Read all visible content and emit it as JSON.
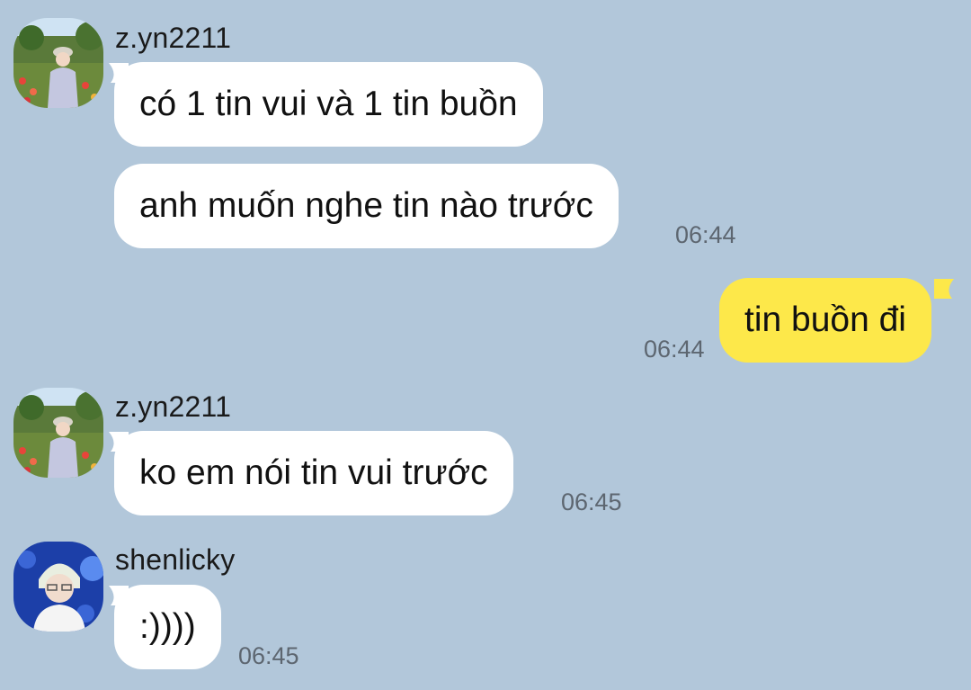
{
  "chat": {
    "messages": [
      {
        "sender": "z.yn2211",
        "avatar": "avatar-zyn2211",
        "text": "có 1 tin vui và 1 tin buồn"
      },
      {
        "sender": "z.yn2211",
        "text": "anh muốn nghe tin nào trước",
        "time": "06:44"
      },
      {
        "sender": "me",
        "text": "tin buồn đi",
        "time": "06:44"
      },
      {
        "sender": "z.yn2211",
        "avatar": "avatar-zyn2211",
        "text": "ko em nói tin vui trước",
        "time": "06:45"
      },
      {
        "sender": "shenlicky",
        "avatar": "avatar-shenlicky",
        "text": ":))))",
        "time": "06:45"
      }
    ]
  },
  "colors": {
    "background": "#b2c7da",
    "incoming_bubble": "#ffffff",
    "outgoing_bubble": "#fde84a",
    "timestamp": "#5d6670"
  }
}
